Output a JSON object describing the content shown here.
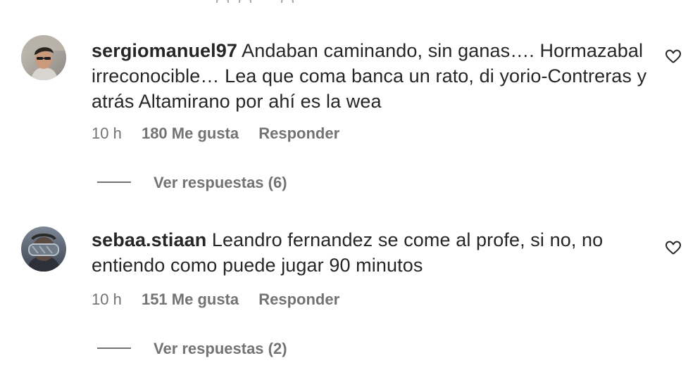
{
  "comments": [
    {
      "username": "sergiomanuel97",
      "text": " Andaban caminando, sin ganas…. Hormazabal irreconocible… Lea que coma banca un rato, di yorio-Contreras y atrás Altamirano por ahí es la wea",
      "time": "10 h",
      "likes": "180 Me gusta",
      "reply_label": "Responder",
      "view_replies": "Ver respuestas (6)",
      "like_icon": "heart-outline-icon"
    },
    {
      "username": "sebaa.stiaan",
      "text": " Leandro fernandez se come al profe, si no, no entiendo como puede jugar 90 minutos",
      "time": "10 h",
      "likes": "151 Me gusta",
      "reply_label": "Responder",
      "view_replies": "Ver respuestas (2)",
      "like_icon": "heart-outline-icon"
    }
  ],
  "colors": {
    "text_primary": "#262626",
    "text_secondary": "#737373",
    "background": "#ffffff"
  }
}
